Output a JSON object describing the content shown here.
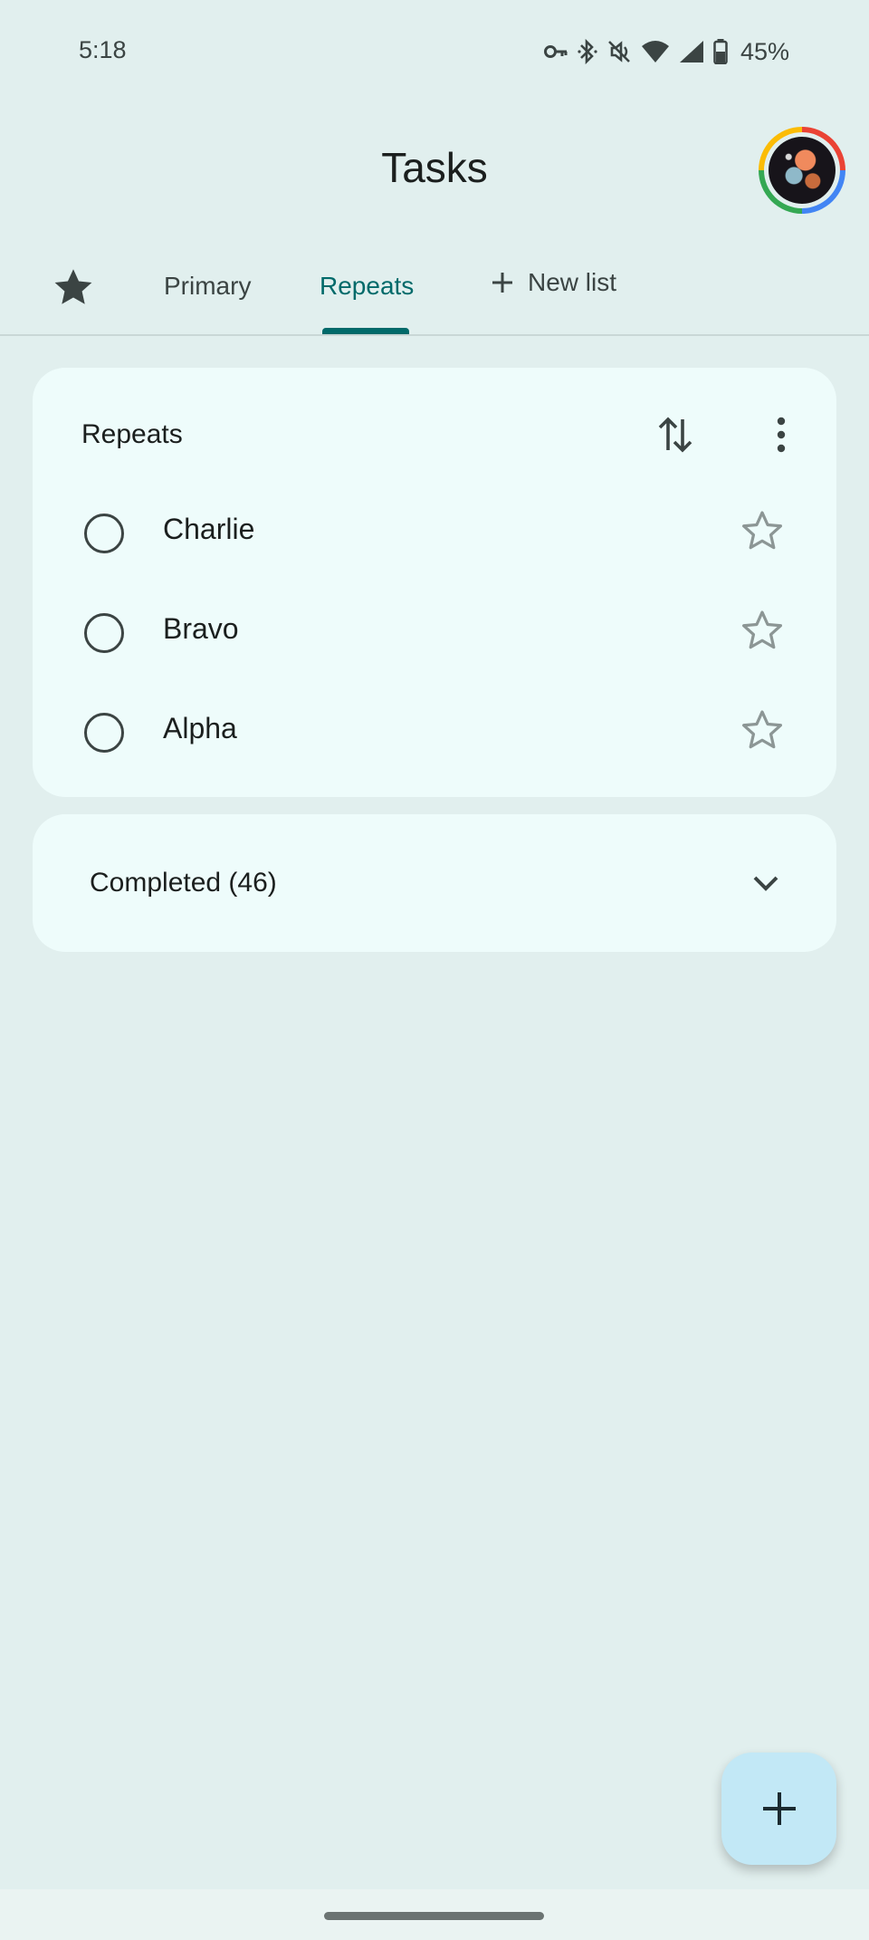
{
  "status_bar": {
    "time": "5:18",
    "battery_percent": "45%",
    "icons": [
      "vpn-key-icon",
      "bluetooth-icon",
      "mute-icon",
      "wifi-icon",
      "signal-icon",
      "battery-icon"
    ]
  },
  "header": {
    "title": "Tasks",
    "avatar_icon": "account-avatar"
  },
  "tabs": {
    "items": [
      {
        "label": "Primary",
        "active": false
      },
      {
        "label": "Repeats",
        "active": true
      }
    ],
    "starred_icon": "star-filled-icon",
    "new_list_label": "New list"
  },
  "list_card": {
    "title": "Repeats",
    "sort_icon": "sort-arrows-icon",
    "more_icon": "more-vert-icon",
    "tasks": [
      {
        "label": "Charlie",
        "starred": false
      },
      {
        "label": "Bravo",
        "starred": false
      },
      {
        "label": "Alpha",
        "starred": false
      }
    ]
  },
  "completed": {
    "label": "Completed (46)",
    "expanded": false
  },
  "fab": {
    "icon": "plus-icon"
  },
  "colors": {
    "background": "#e1efee",
    "card": "#eefcfb",
    "accent": "#006a6a",
    "fab": "#c2e8f6"
  }
}
